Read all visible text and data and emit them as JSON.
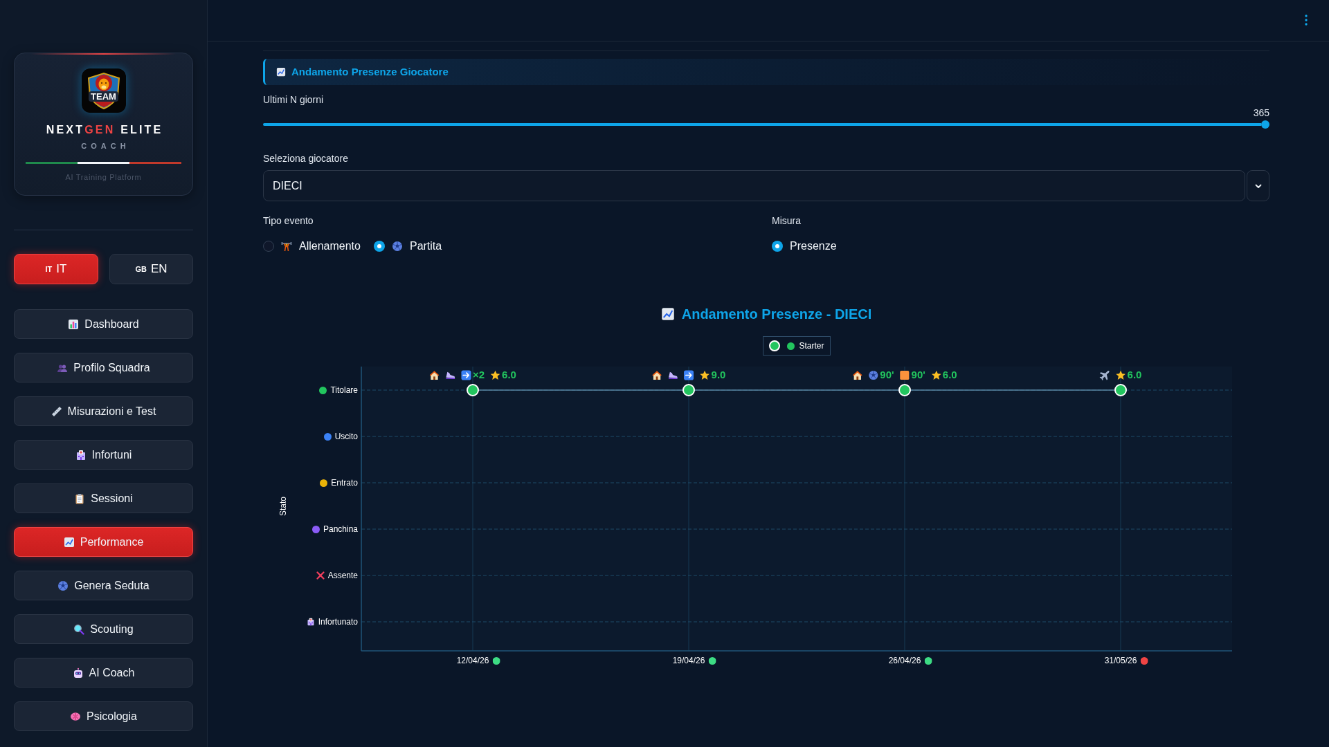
{
  "sidebar": {
    "logo": {
      "text": "TEAM"
    },
    "brand": {
      "title_parts": [
        {
          "text": "NEXT",
          "accent": false
        },
        {
          "text": "GEN",
          "accent": true
        },
        {
          "text": " ELITE",
          "accent": false
        }
      ],
      "subtitle": "COACH",
      "tagline": "AI Training Platform"
    },
    "languages": [
      {
        "code": "IT",
        "label": "IT",
        "selected": true
      },
      {
        "code": "GB",
        "label": "EN",
        "selected": false
      }
    ],
    "nav": [
      {
        "label": "Dashboard",
        "selected": false
      },
      {
        "label": "Profilo Squadra",
        "selected": false
      },
      {
        "label": "Misurazioni e Test",
        "selected": false
      },
      {
        "label": "Infortuni",
        "selected": false
      },
      {
        "label": "Sessioni",
        "selected": false
      },
      {
        "label": "Performance",
        "selected": true
      },
      {
        "label": "Genera Seduta",
        "selected": false
      },
      {
        "label": "Scouting",
        "selected": false
      },
      {
        "label": "AI Coach",
        "selected": false
      },
      {
        "label": "Psicologia",
        "selected": false
      }
    ]
  },
  "main": {
    "section_title": "Andamento Presenze Giocatore",
    "days_slider": {
      "label": "Ultimi N giorni",
      "reading": "365",
      "level": 1
    },
    "player_select": {
      "label": "Seleziona giocatore",
      "value": "DIECI"
    },
    "event_type": {
      "label": "Tipo evento",
      "options": [
        {
          "label": "Allenamento",
          "selected": false
        },
        {
          "label": "Partita",
          "selected": true
        }
      ]
    },
    "measure": {
      "label": "Misura",
      "options": [
        {
          "label": "Presenze",
          "selected": true
        }
      ]
    },
    "status_chart": {
      "title": "Andamento Presenze - DIECI",
      "legend": [
        {
          "name": "Starter",
          "color": "#22c55e"
        }
      ],
      "axis_title": "Stato",
      "statuses": [
        {
          "label": "Titolare",
          "kind": "dot",
          "color": "#22c55e",
          "cells": [
            {
              "marked": true
            },
            {
              "marked": true
            },
            {
              "marked": true
            },
            {
              "marked": true
            }
          ]
        },
        {
          "label": "Uscito",
          "kind": "dot",
          "color": "#3b82f6",
          "cells": [
            {
              "marked": false
            },
            {
              "marked": false
            },
            {
              "marked": false
            },
            {
              "marked": false
            }
          ]
        },
        {
          "label": "Entrato",
          "kind": "dot",
          "color": "#eab308",
          "cells": [
            {
              "marked": false
            },
            {
              "marked": false
            },
            {
              "marked": false
            },
            {
              "marked": false
            }
          ]
        },
        {
          "label": "Panchina",
          "kind": "dot",
          "color": "#8b5cf6",
          "cells": [
            {
              "marked": false
            },
            {
              "marked": false
            },
            {
              "marked": false
            },
            {
              "marked": false
            }
          ]
        },
        {
          "label": "Assente",
          "kind": "cross",
          "color": "#f43f5e",
          "cells": [
            {
              "marked": false
            },
            {
              "marked": false
            },
            {
              "marked": false
            },
            {
              "marked": false
            }
          ]
        },
        {
          "label": "Infortunato",
          "kind": "hospital",
          "cells": [
            {
              "marked": false
            },
            {
              "marked": false
            },
            {
              "marked": false
            },
            {
              "marked": false
            }
          ]
        }
      ],
      "dates": [
        {
          "label": "12/04/26",
          "color": "#3ddc84",
          "marks": [
            {
              "kind": "house"
            },
            {
              "kind": "shoe"
            },
            {
              "kind": "arrow",
              "text": "×2"
            },
            {
              "kind": "star",
              "text": "6.0"
            }
          ]
        },
        {
          "label": "19/04/26",
          "color": "#3ddc84",
          "marks": [
            {
              "kind": "house"
            },
            {
              "kind": "shoe"
            },
            {
              "kind": "arrow"
            },
            {
              "kind": "star",
              "text": "9.0"
            }
          ]
        },
        {
          "label": "26/04/26",
          "color": "#3ddc84",
          "marks": [
            {
              "kind": "house"
            },
            {
              "kind": "ball",
              "text": "90'"
            },
            {
              "kind": "square",
              "text": "90'"
            },
            {
              "kind": "star",
              "text": "6.0"
            }
          ]
        },
        {
          "label": "31/05/26",
          "color": "#ef4444",
          "marks": [
            {
              "kind": "plane"
            },
            {
              "kind": "star",
              "text": "6.0"
            }
          ]
        }
      ]
    }
  }
}
